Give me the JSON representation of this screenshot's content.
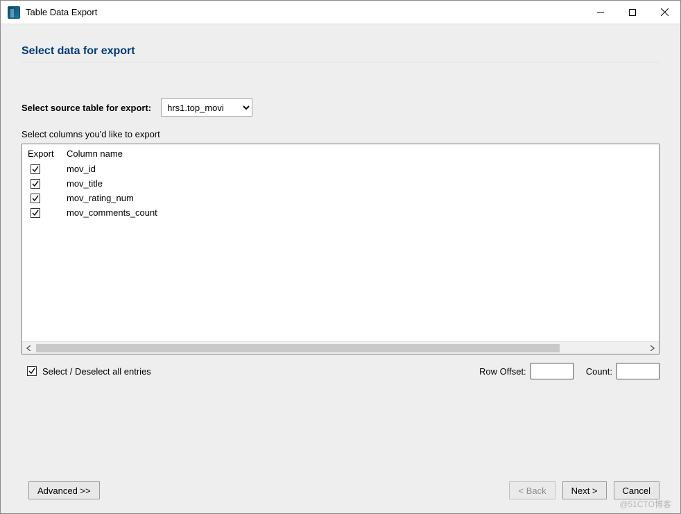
{
  "window": {
    "title": "Table Data Export"
  },
  "heading": "Select data for export",
  "sourceLabel": "Select source table for export:",
  "sourceValue": "hrs1.top_movi",
  "columnsHint": "Select columns you'd like to export",
  "columns": {
    "headers": {
      "export": "Export",
      "name": "Column name"
    },
    "rows": [
      {
        "checked": true,
        "name": "mov_id"
      },
      {
        "checked": true,
        "name": "mov_title"
      },
      {
        "checked": true,
        "name": "mov_rating_num"
      },
      {
        "checked": true,
        "name": "mov_comments_count"
      }
    ]
  },
  "selectAll": {
    "checked": true,
    "label": "Select / Deselect all entries"
  },
  "rowOffset": {
    "label": "Row Offset:",
    "value": ""
  },
  "count": {
    "label": "Count:",
    "value": ""
  },
  "buttons": {
    "advanced": "Advanced >>",
    "back": "< Back",
    "next": "Next >",
    "cancel": "Cancel"
  },
  "watermark": "@51CTO博客"
}
